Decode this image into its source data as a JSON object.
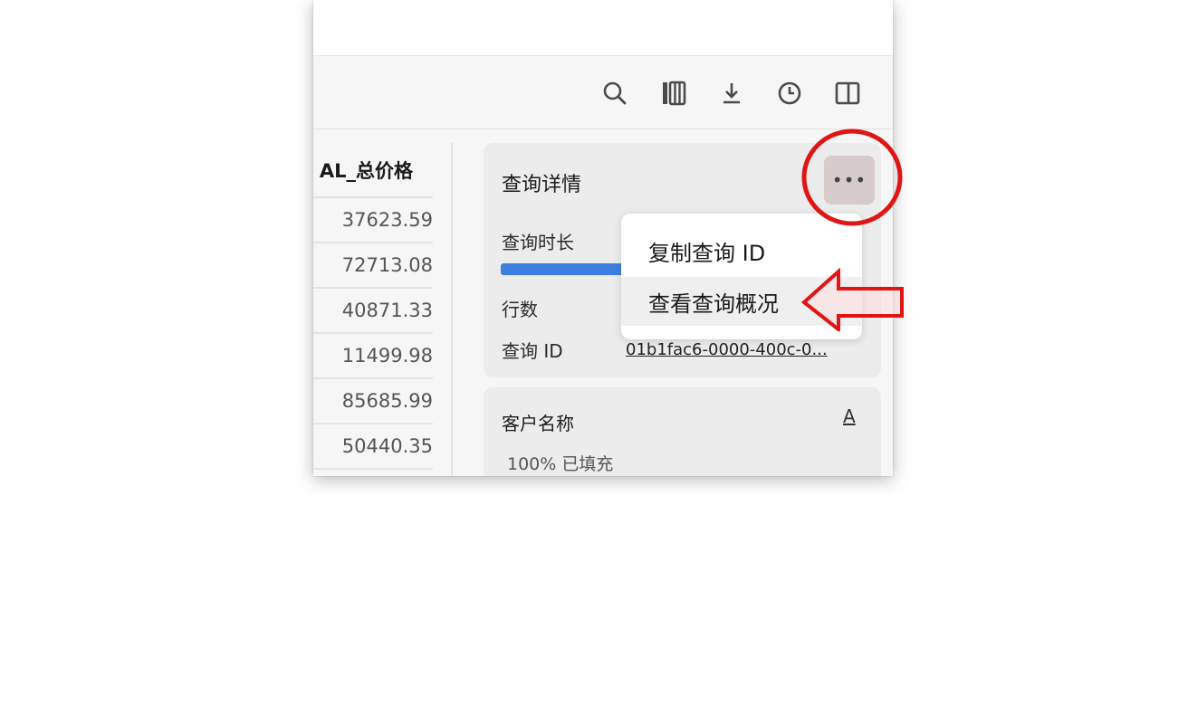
{
  "toolbar": {
    "icons": [
      "search-icon",
      "columns-icon",
      "download-icon",
      "history-icon",
      "panel-icon"
    ]
  },
  "table": {
    "header": "AL_总价格",
    "rows": [
      "37623.59",
      "72713.08",
      "40871.33",
      "11499.98",
      "85685.99",
      "50440.35"
    ]
  },
  "query_details": {
    "title": "查询详情",
    "more_label": "•••",
    "duration_label": "查询时长",
    "rows_label": "行数",
    "id_label": "查询 ID",
    "id_value": "01b1fac6-0000-400c-0..."
  },
  "menu": {
    "items": [
      "复制查询 ID",
      "查看查询概况"
    ]
  },
  "column_card": {
    "title": "客户名称",
    "type_icon": "A",
    "fill": "100% 已填充"
  },
  "colors": {
    "accent_blue": "#3d7fe0",
    "annotation_red": "#e01515"
  }
}
